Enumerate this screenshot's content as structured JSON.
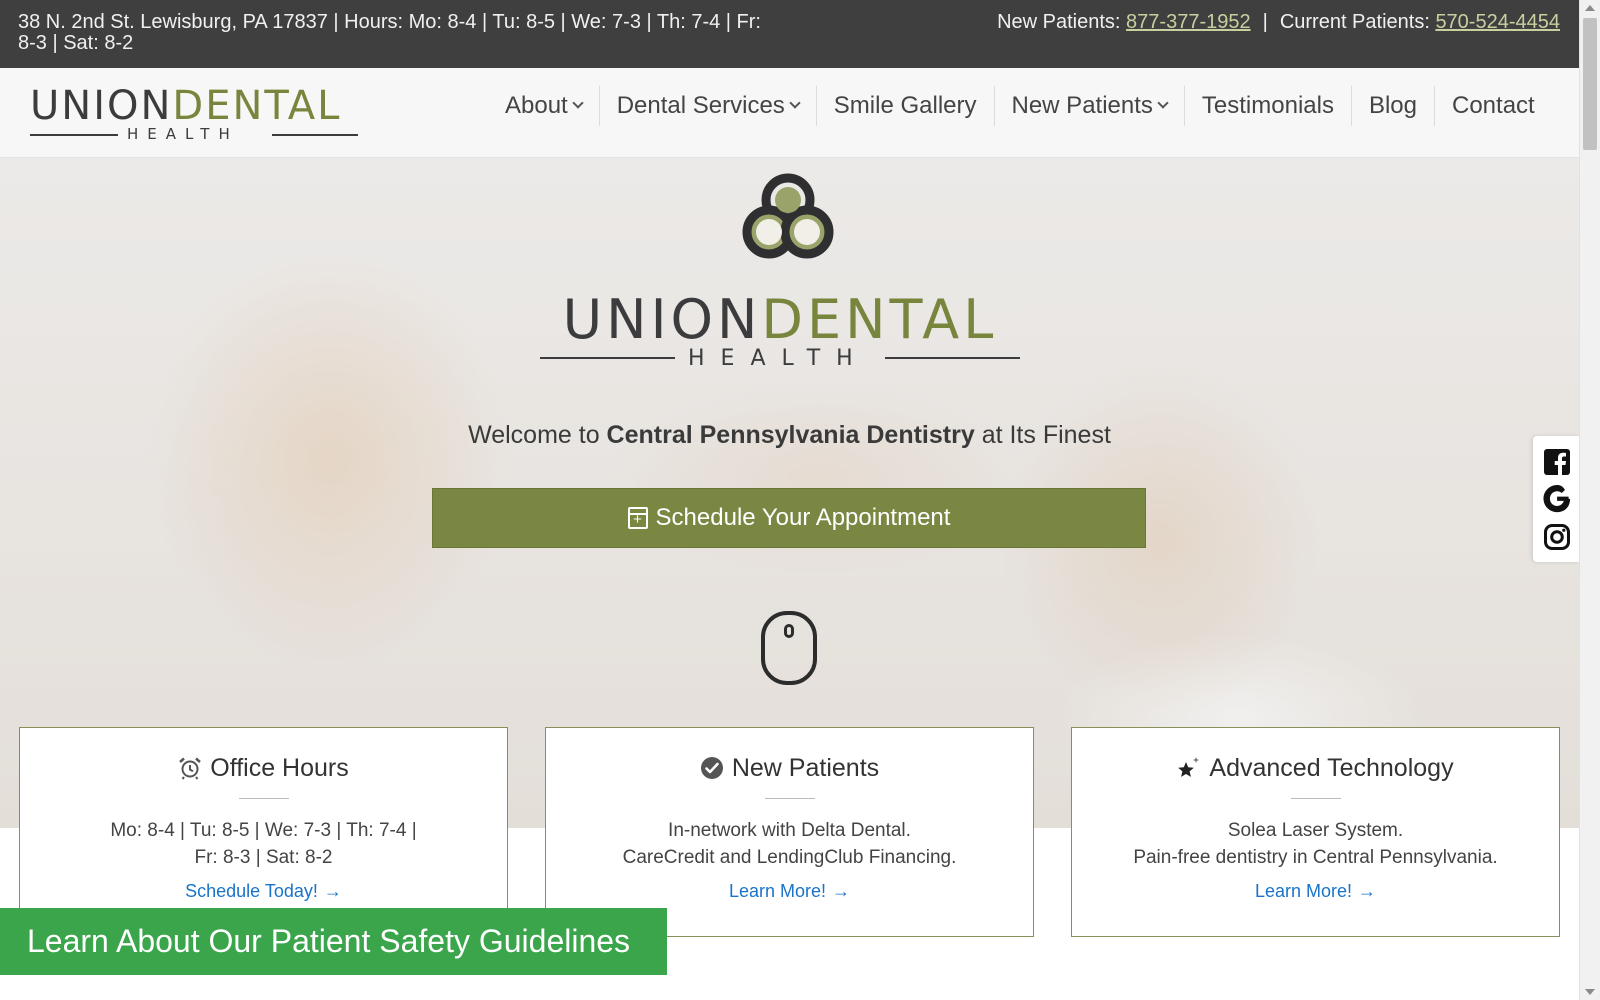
{
  "topbar": {
    "info": "38 N. 2nd St. Lewisburg, PA 17837  | Hours: Mo: 8-4 | Tu: 8-5 | We: 7-3 | Th: 7-4 | Fr: 8-3 | Sat: 8-2",
    "new_patients_label": "New Patients: ",
    "new_patients_phone": "877-377-1952",
    "separator": "|",
    "current_patients_label": "Current Patients: ",
    "current_patients_phone": "570-524-4454"
  },
  "logo": {
    "union": "UNION",
    "dental": "DENTAL",
    "health": "HEALTH"
  },
  "nav": {
    "items": [
      {
        "label": "About"
      },
      {
        "label": "Dental Services"
      },
      {
        "label": "Smile Gallery"
      },
      {
        "label": "New Patients"
      },
      {
        "label": "Testimonials"
      },
      {
        "label": "Blog"
      },
      {
        "label": "Contact"
      }
    ]
  },
  "hero": {
    "welcome_pre": "Welcome to ",
    "welcome_bold": "Central Pennsylvania Dentistry",
    "welcome_post": " at Its Finest",
    "cta_label": "Schedule Your Appointment"
  },
  "cards": [
    {
      "icon": "alarm-clock-icon",
      "title": "Office Hours",
      "line1": "Mo: 8-4 | Tu: 8-5 | We: 7-3 | Th: 7-4 |",
      "line2": "Fr: 8-3 | Sat: 8-2",
      "link": "Schedule Today!"
    },
    {
      "icon": "check-circle-icon",
      "title": "New Patients",
      "line1": "In-network with Delta Dental.",
      "line2": "CareCredit and LendingClub Financing.",
      "link": "Learn More!"
    },
    {
      "icon": "sparkle-star-icon",
      "title": "Advanced Technology",
      "line1": "Solea Laser System.",
      "line2": "Pain-free dentistry in Central Pennsylvania.",
      "link": "Learn More!"
    }
  ],
  "safety_banner": "Learn About Our Patient Safety Guidelines",
  "social": [
    "facebook-icon",
    "google-icon",
    "instagram-icon"
  ],
  "colors": {
    "brand_green": "#798743",
    "logo_green": "#78853d",
    "topbar_bg": "#3f3f40",
    "safety_green": "#3aa54b",
    "link_blue": "#1a73c8"
  }
}
